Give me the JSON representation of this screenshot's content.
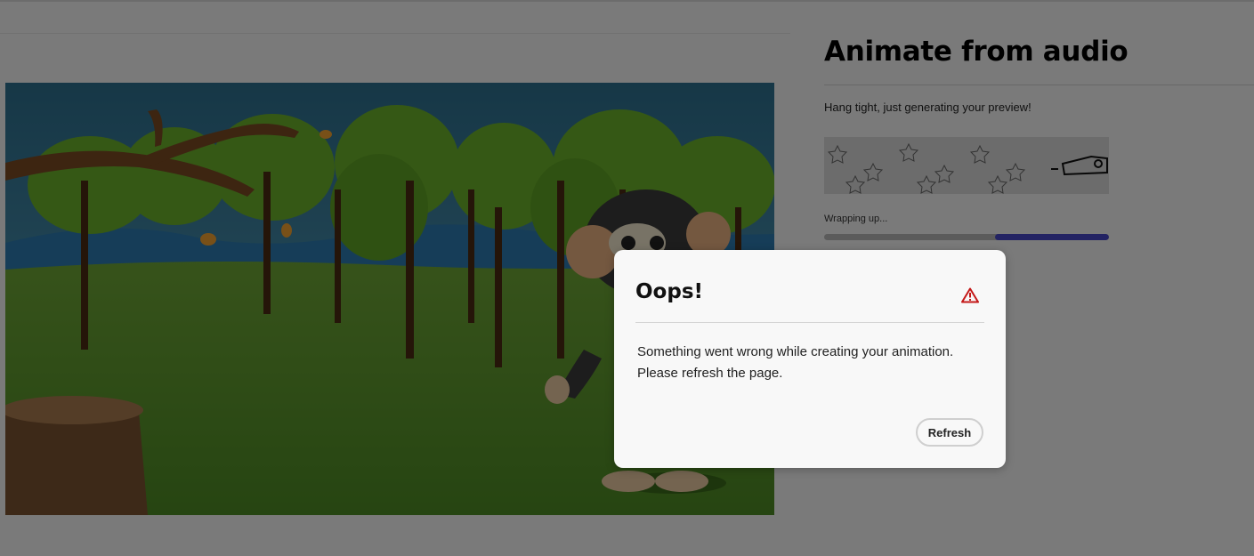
{
  "panel": {
    "title": "Animate from audio",
    "status_message": "Hang tight, just generating your preview!",
    "progress_label": "Wrapping up...",
    "progress_fraction": 0.4
  },
  "dialog": {
    "title": "Oops!",
    "message_line1": "Something went wrong while creating your animation.",
    "message_line2": "Please refresh the page.",
    "refresh_label": "Refresh",
    "icon": "alert-triangle-icon"
  },
  "colors": {
    "progress_fill": "#4646c6",
    "alert_icon": "#c41818",
    "overlay": "rgba(0,0,0,0.5)"
  }
}
